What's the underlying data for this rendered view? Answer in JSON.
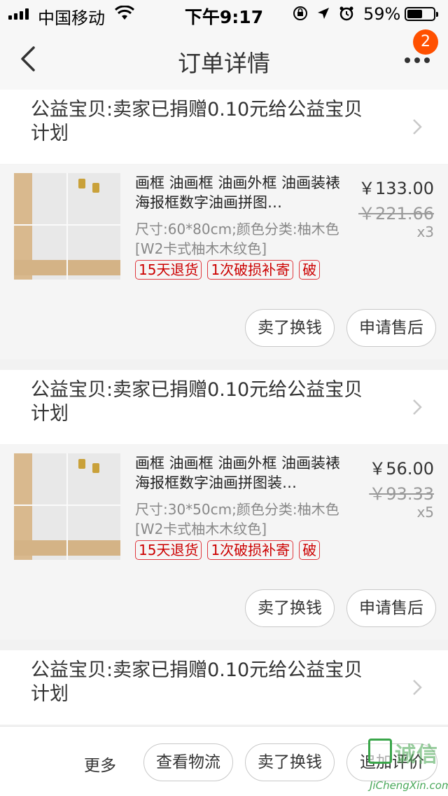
{
  "status_bar": {
    "carrier": "中国移动",
    "time": "下午9:17",
    "battery_percent": "59%",
    "battery_level": 0.59
  },
  "nav": {
    "title": "订单详情",
    "badge_count": "2"
  },
  "charity": {
    "text": "公益宝贝:卖家已捐赠0.10元给公益宝贝计划"
  },
  "items": [
    {
      "title": "画框 油画框 油画外框 油画装裱 海报框数字油画拼图…",
      "sku": "尺寸:60*80cm;颜色分类:柚木色[W2卡式柚木木纹色]",
      "price": "￥133.00",
      "original_price": "￥221.66",
      "quantity": "x3",
      "tags": [
        "15天退货",
        "1次破损补寄",
        "破"
      ],
      "buttons": {
        "sell": "卖了换钱",
        "after_sale": "申请售后"
      }
    },
    {
      "title": "画框 油画框 油画外框 油画装裱 海报框数字油画拼图装…",
      "sku": "尺寸:30*50cm;颜色分类:柚木色[W2卡式柚木木纹色]",
      "price": "￥56.00",
      "original_price": "￥93.33",
      "quantity": "x5",
      "tags": [
        "15天退货",
        "1次破损补寄",
        "破"
      ],
      "buttons": {
        "sell": "卖了换钱",
        "after_sale": "申请售后"
      }
    }
  ],
  "bottom_bar": {
    "more": "更多",
    "logistics": "查看物流",
    "sell": "卖了换钱",
    "review": "追加评价"
  },
  "watermark": {
    "cn": "诚信",
    "en": "JiChengXin.com"
  },
  "icons": {
    "back": "chevron-left-icon",
    "more": "more-dots-icon",
    "row_arrow": "chevron-right-icon"
  },
  "colors": {
    "accent": "#ff5000",
    "tag_red": "#e0383e"
  }
}
